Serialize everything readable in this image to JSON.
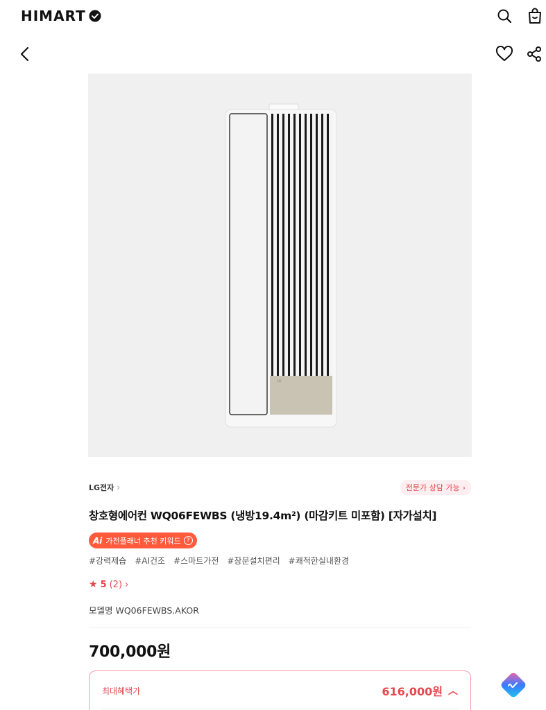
{
  "header": {
    "logo_text": "HIMART",
    "icons": [
      "search-icon",
      "shopping-bag-icon",
      "back-arrow-icon",
      "heart-icon",
      "share-icon"
    ]
  },
  "product": {
    "brand": "LG전자",
    "consult_badge": "전문가 상담 가능",
    "title": "창호형에어컨 WQ06FEWBS (냉방19.4m²) (마감키트 미포함) [자가설치]",
    "ai_badge": "가전플래너 추천 키워드",
    "ai_mark": "Ai",
    "tags": [
      "#강력제습",
      "#AI건조",
      "#스마트가전",
      "#창문설치편리",
      "#쾌적한실내환경"
    ],
    "rating": {
      "score": "5",
      "count": "(2)"
    },
    "model": "모델명 WQ06FEWBS.AKOR",
    "price": "700,000원",
    "benefit": {
      "label": "최대혜택가",
      "price": "616,000원"
    }
  },
  "colors": {
    "accent": "#e5484d",
    "ai_badge": "#ff5a3c",
    "image_bg": "#f0f0f0"
  }
}
